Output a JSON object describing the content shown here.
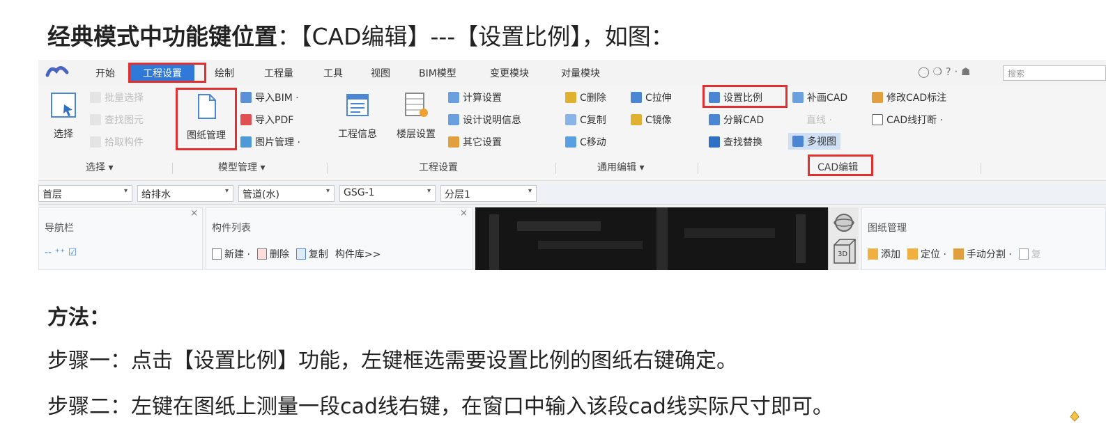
{
  "heading": {
    "bold": "经典模式中功能键位置",
    "rest": "：【CAD编辑】---【设置比例】，如图："
  },
  "menubar": {
    "items": [
      "开始",
      "工程设置",
      "绘制",
      "工程量",
      "工具",
      "视图",
      "BIM模型",
      "变更模块",
      "对量模块"
    ],
    "active": "工程设置",
    "search_placeholder": "搜索",
    "right_icons": "◯ ❍ ? · ☗"
  },
  "ribbon": {
    "select_group": {
      "big_label": "选择",
      "dim_items": [
        "批量选择",
        "查找图元",
        "拾取构件"
      ],
      "group_label": "选择 ▾"
    },
    "model_group": {
      "big_label": "图纸管理",
      "items": [
        "导入BIM ·",
        "导入PDF",
        "图片管理 ·"
      ],
      "group_label": "模型管理 ▾"
    },
    "project_group": {
      "big1": "工程信息",
      "big2": "楼层设置",
      "items": [
        "计算设置",
        "设计说明信息",
        "其它设置"
      ],
      "group_label": "工程设置"
    },
    "edit_group": {
      "col1": [
        "C删除",
        "C复制",
        "C移动"
      ],
      "col2": [
        "C拉伸",
        "C镜像"
      ],
      "group_label": "通用编辑 ▾"
    },
    "cad_group": {
      "col1": [
        "设置比例",
        "分解CAD",
        "查找替换"
      ],
      "col2": [
        "补画CAD",
        "直线 ·",
        "多视图"
      ],
      "col3": [
        "修改CAD标注",
        "CAD线打断 ·"
      ],
      "group_label": "CAD编辑"
    }
  },
  "combos": [
    "首层",
    "给排水",
    "管道(水)",
    "GSG-1",
    "分层1"
  ],
  "panels": {
    "nav": {
      "title": "导航栏",
      "close": "×",
      "tools": "-‐ ⁺⁺ ☑"
    },
    "list": {
      "title": "构件列表",
      "close": "×",
      "new": "新建 ·",
      "delete": "删除",
      "copy": "复制",
      "library": "构件库>>"
    },
    "drawing": {
      "title": "图纸管理",
      "add": "添加",
      "locate": "定位 ·",
      "split": "手动分割 ·",
      "more": "复"
    }
  },
  "view_cube": {
    "label": "3D"
  },
  "method_title": "方法：",
  "steps": [
    "步骤一：点击【设置比例】功能，左键框选需要设置比例的图纸右键确定。",
    "步骤二：左键在图纸上测量一段cad线右键，在窗口中输入该段cad线实际尺寸即可。"
  ],
  "colors": {
    "highlight": "#e23030",
    "active_tab": "#2f7ad8"
  }
}
